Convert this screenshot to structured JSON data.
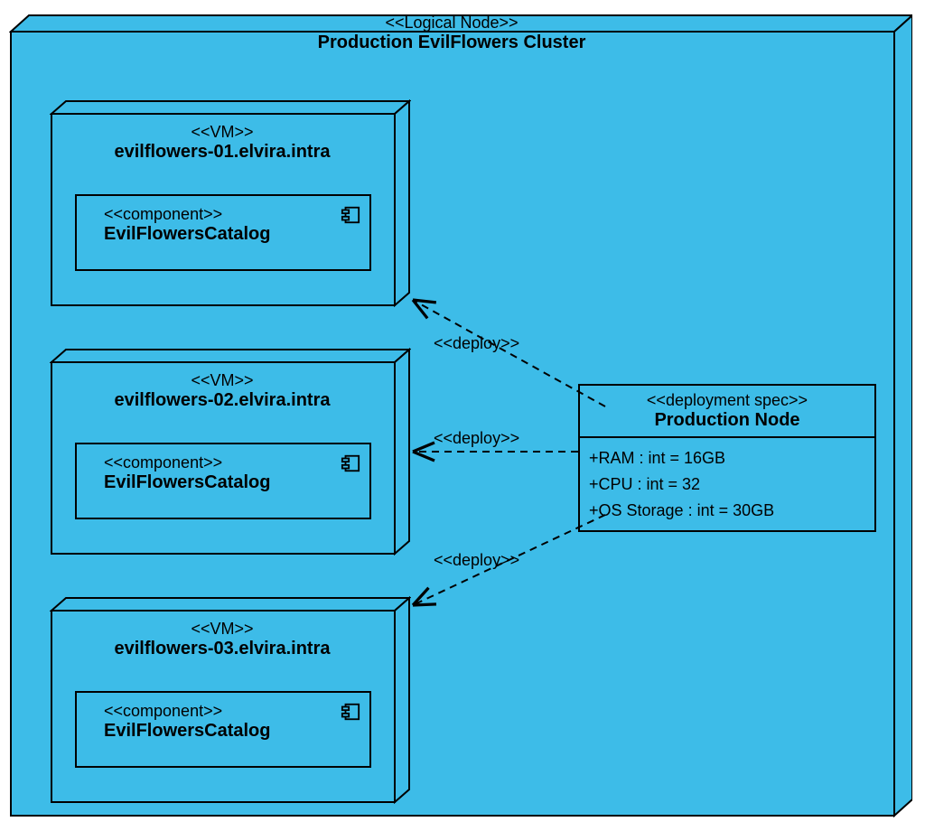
{
  "cluster": {
    "stereotype": "<<Logical Node>>",
    "name": "Production EvilFlowers Cluster"
  },
  "vms": [
    {
      "stereotype": "<<VM>>",
      "hostname": "evilflowers-01.elvira.intra",
      "component": {
        "stereotype": "<<component>>",
        "name": "EvilFlowersCatalog"
      }
    },
    {
      "stereotype": "<<VM>>",
      "hostname": "evilflowers-02.elvira.intra",
      "component": {
        "stereotype": "<<component>>",
        "name": "EvilFlowersCatalog"
      }
    },
    {
      "stereotype": "<<VM>>",
      "hostname": "evilflowers-03.elvira.intra",
      "component": {
        "stereotype": "<<component>>",
        "name": "EvilFlowersCatalog"
      }
    }
  ],
  "spec": {
    "stereotype": "<<deployment spec>>",
    "name": "Production Node",
    "attrs": [
      "+RAM : int = 16GB",
      "+CPU : int = 32",
      "+OS Storage : int = 30GB"
    ]
  },
  "deploy_label": "<<deploy>>",
  "colors": {
    "fill": "#3dbce8"
  }
}
